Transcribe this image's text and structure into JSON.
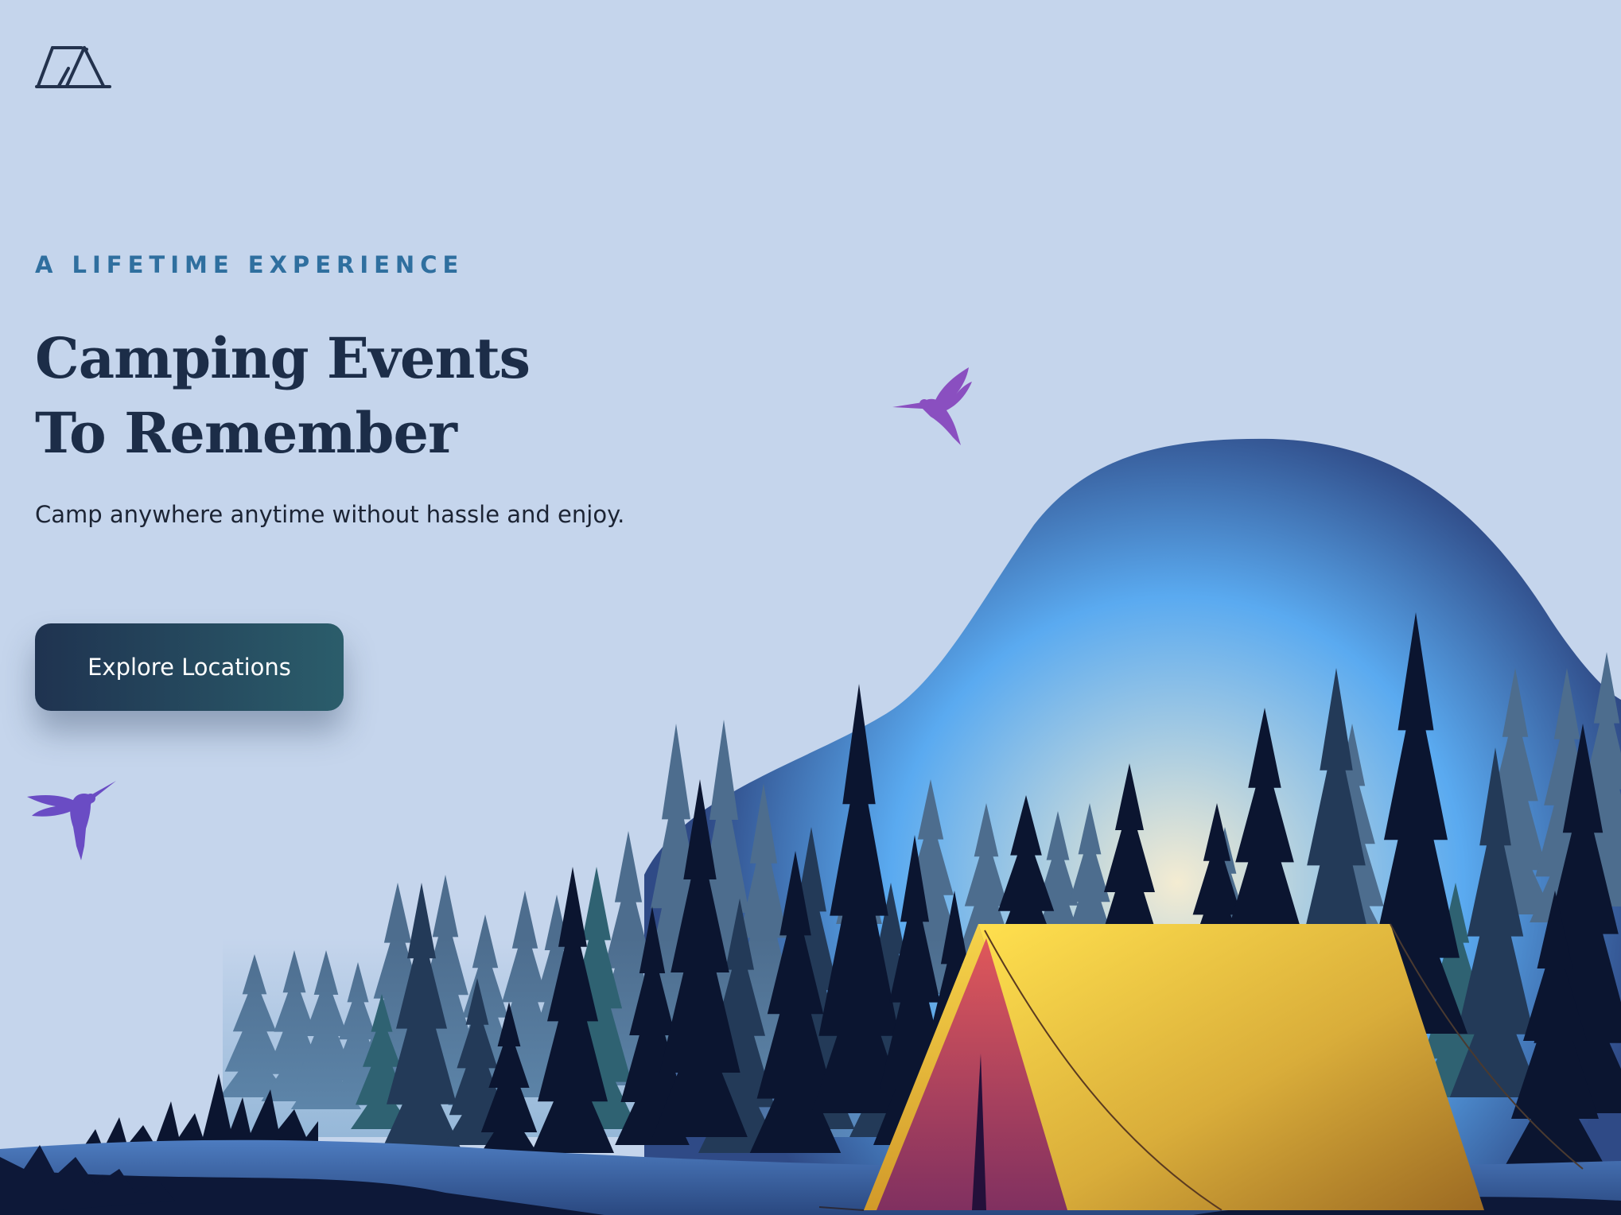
{
  "header": {
    "logo_icon": "tent-icon"
  },
  "hero": {
    "eyebrow": "A LIFETIME EXPERIENCE",
    "title_line1": "Camping Events",
    "title_line2": "To Remember",
    "subtitle": "Camp anywhere anytime without hassle and enjoy.",
    "cta_label": "Explore Locations"
  },
  "illustration": {
    "icons": [
      "hummingbird-icon",
      "hummingbird-icon",
      "camping-tent-icon",
      "pine-forest"
    ],
    "colors": {
      "background": "#c5d5ec",
      "sky_top": "#2f4a86",
      "sky_mid": "#5aaaf0",
      "sky_glow": "#f2ead0",
      "tent_yellow": "#f2c73c",
      "tent_red": "#d8505a",
      "bird_purple": "#8a4fc0",
      "bird_violet": "#6a4cc4",
      "tree_dark": "#0b1530",
      "tree_slate": "#4a6a8a",
      "tree_teal": "#2f6070",
      "ground_blue": "#3f6aa8",
      "accent_text": "#2f6f9f",
      "button": "#1f3350"
    }
  }
}
